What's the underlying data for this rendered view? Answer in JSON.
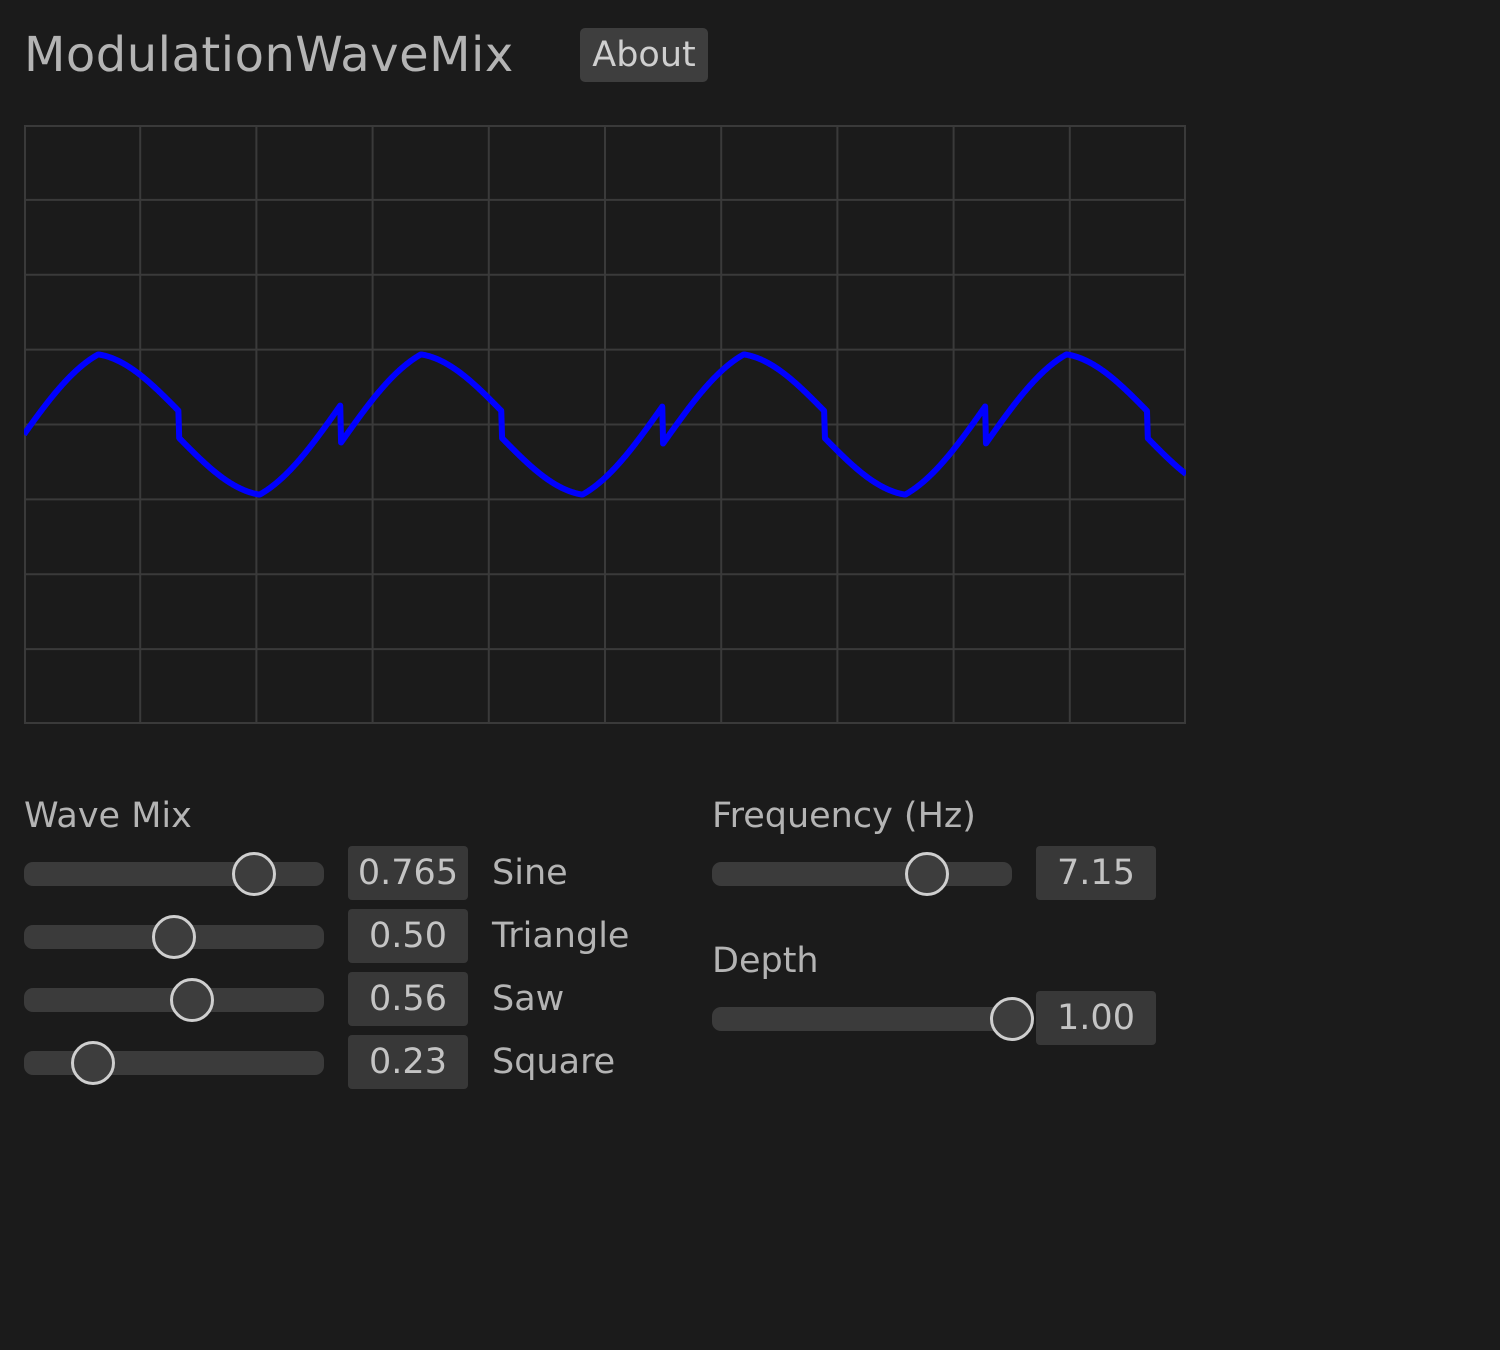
{
  "app": {
    "title": "ModulationWaveMix",
    "about_label": "About"
  },
  "scope": {
    "grid_color": "#3a3a3a",
    "wave_color": "#0000ff",
    "cycles": 3.6,
    "amplitude_scale": 0.18
  },
  "wave_mix": {
    "label": "Wave Mix",
    "items": [
      {
        "name": "Sine",
        "value_text": "0.765",
        "level": 0.765
      },
      {
        "name": "Triangle",
        "value_text": "0.50",
        "level": 0.5
      },
      {
        "name": "Saw",
        "value_text": "0.56",
        "level": 0.56
      },
      {
        "name": "Square",
        "value_text": "0.23",
        "level": 0.23
      }
    ]
  },
  "frequency": {
    "label": "Frequency (Hz)",
    "value_text": "7.15",
    "level": 0.715
  },
  "depth": {
    "label": "Depth",
    "value_text": "1.00",
    "level": 1.0
  }
}
